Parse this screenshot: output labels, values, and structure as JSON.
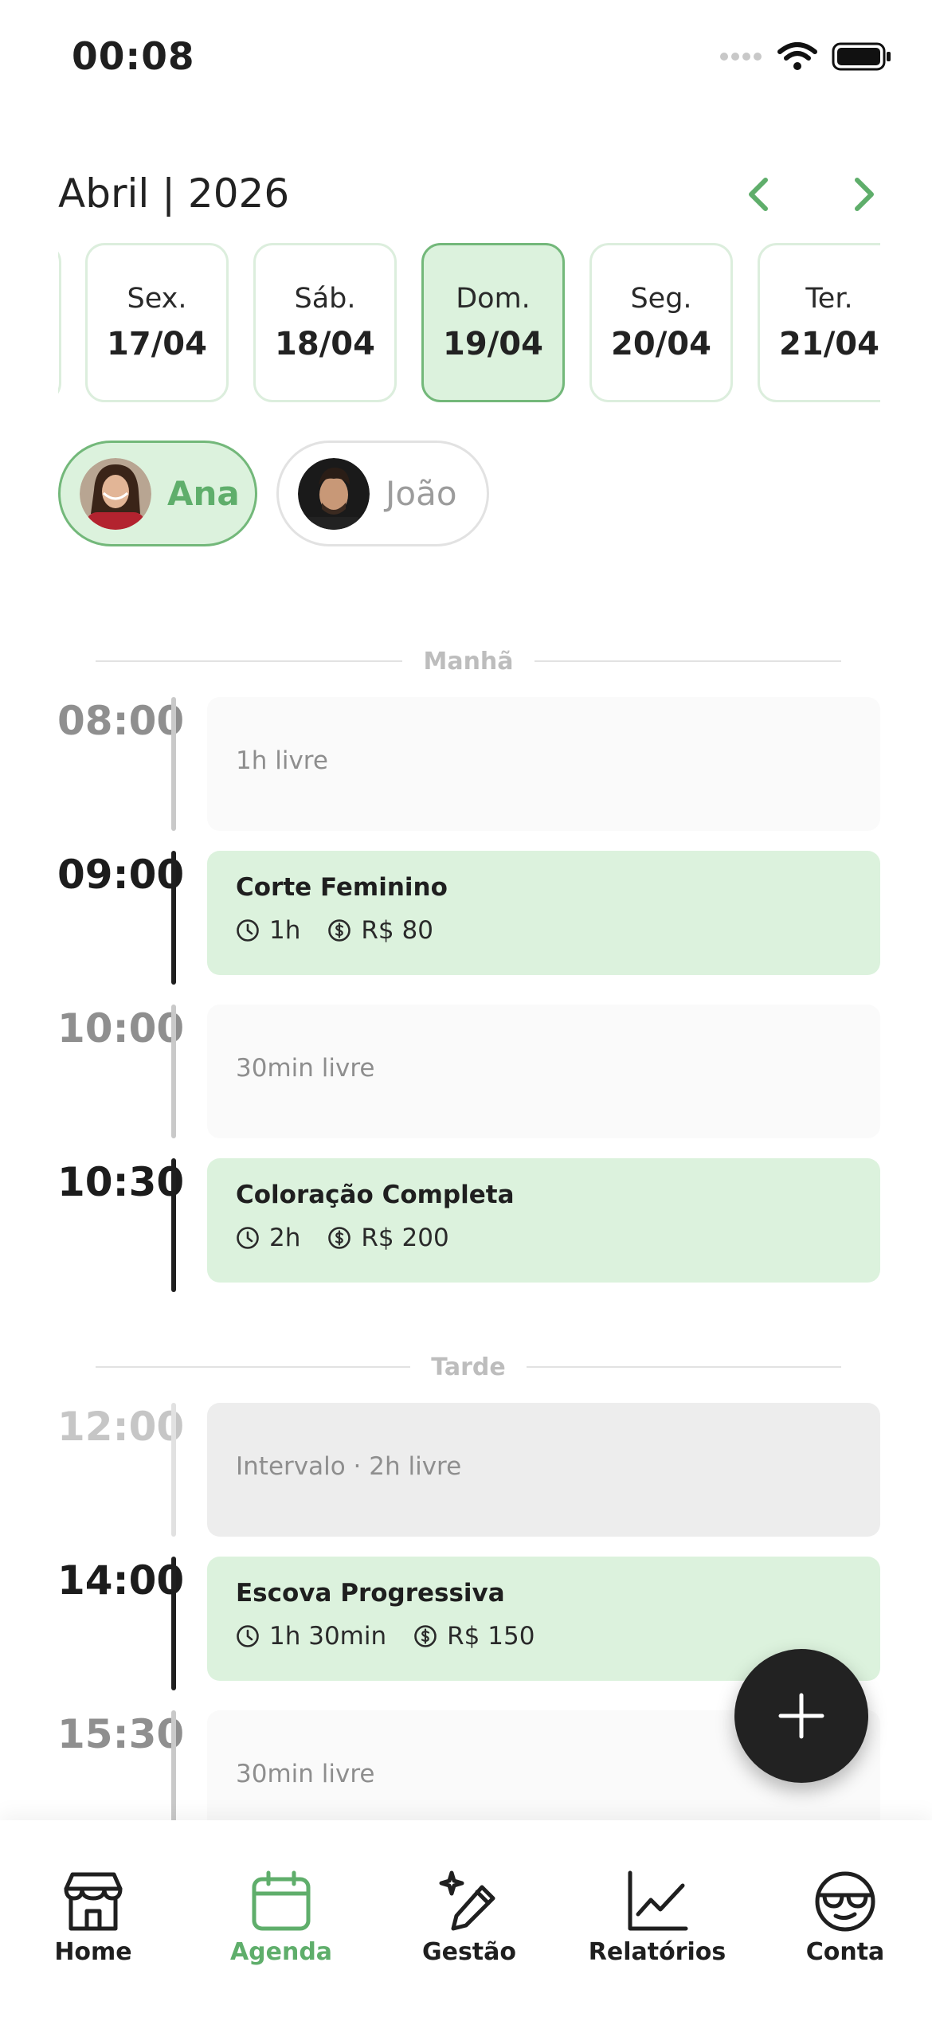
{
  "status_bar": {
    "time": "00:08"
  },
  "header": {
    "month_title": "Abril | 2026"
  },
  "days": [
    {
      "name": "Sex.",
      "date": "17/04",
      "selected": false
    },
    {
      "name": "Sáb.",
      "date": "18/04",
      "selected": false
    },
    {
      "name": "Dom.",
      "date": "19/04",
      "selected": true
    },
    {
      "name": "Seg.",
      "date": "20/04",
      "selected": false
    },
    {
      "name": "Ter.",
      "date": "21/04",
      "selected": false
    }
  ],
  "professionals": [
    {
      "name": "Ana",
      "selected": true
    },
    {
      "name": "João",
      "selected": false
    }
  ],
  "sections": {
    "morning": "Manhã",
    "afternoon": "Tarde"
  },
  "slots": [
    {
      "time": "08:00",
      "kind": "free",
      "label": "1h livre"
    },
    {
      "time": "09:00",
      "kind": "booked",
      "service": "Corte Feminino",
      "duration": "1h",
      "price": "R$ 80"
    },
    {
      "time": "10:00",
      "kind": "free",
      "label": "30min livre"
    },
    {
      "time": "10:30",
      "kind": "booked",
      "service": "Coloração Completa",
      "duration": "2h",
      "price": "R$ 200"
    },
    {
      "time": "12:00",
      "kind": "break",
      "label": "Intervalo · 2h livre"
    },
    {
      "time": "14:00",
      "kind": "booked",
      "service": "Escova Progressiva",
      "duration": "1h 30min",
      "price": "R$ 150"
    },
    {
      "time": "15:30",
      "kind": "free",
      "label": "30min livre"
    }
  ],
  "bottom_nav": [
    {
      "label": "Home",
      "icon": "store-icon",
      "active": false
    },
    {
      "label": "Agenda",
      "icon": "calendar-icon",
      "active": true
    },
    {
      "label": "Gestão",
      "icon": "pencil-sparkle-icon",
      "active": false
    },
    {
      "label": "Relatórios",
      "icon": "chart-icon",
      "active": false
    },
    {
      "label": "Conta",
      "icon": "sunglasses-face-icon",
      "active": false
    }
  ],
  "colors": {
    "accent_green": "#5fae6b",
    "selected_bg": "#dcf2dd",
    "dark": "#222222"
  }
}
